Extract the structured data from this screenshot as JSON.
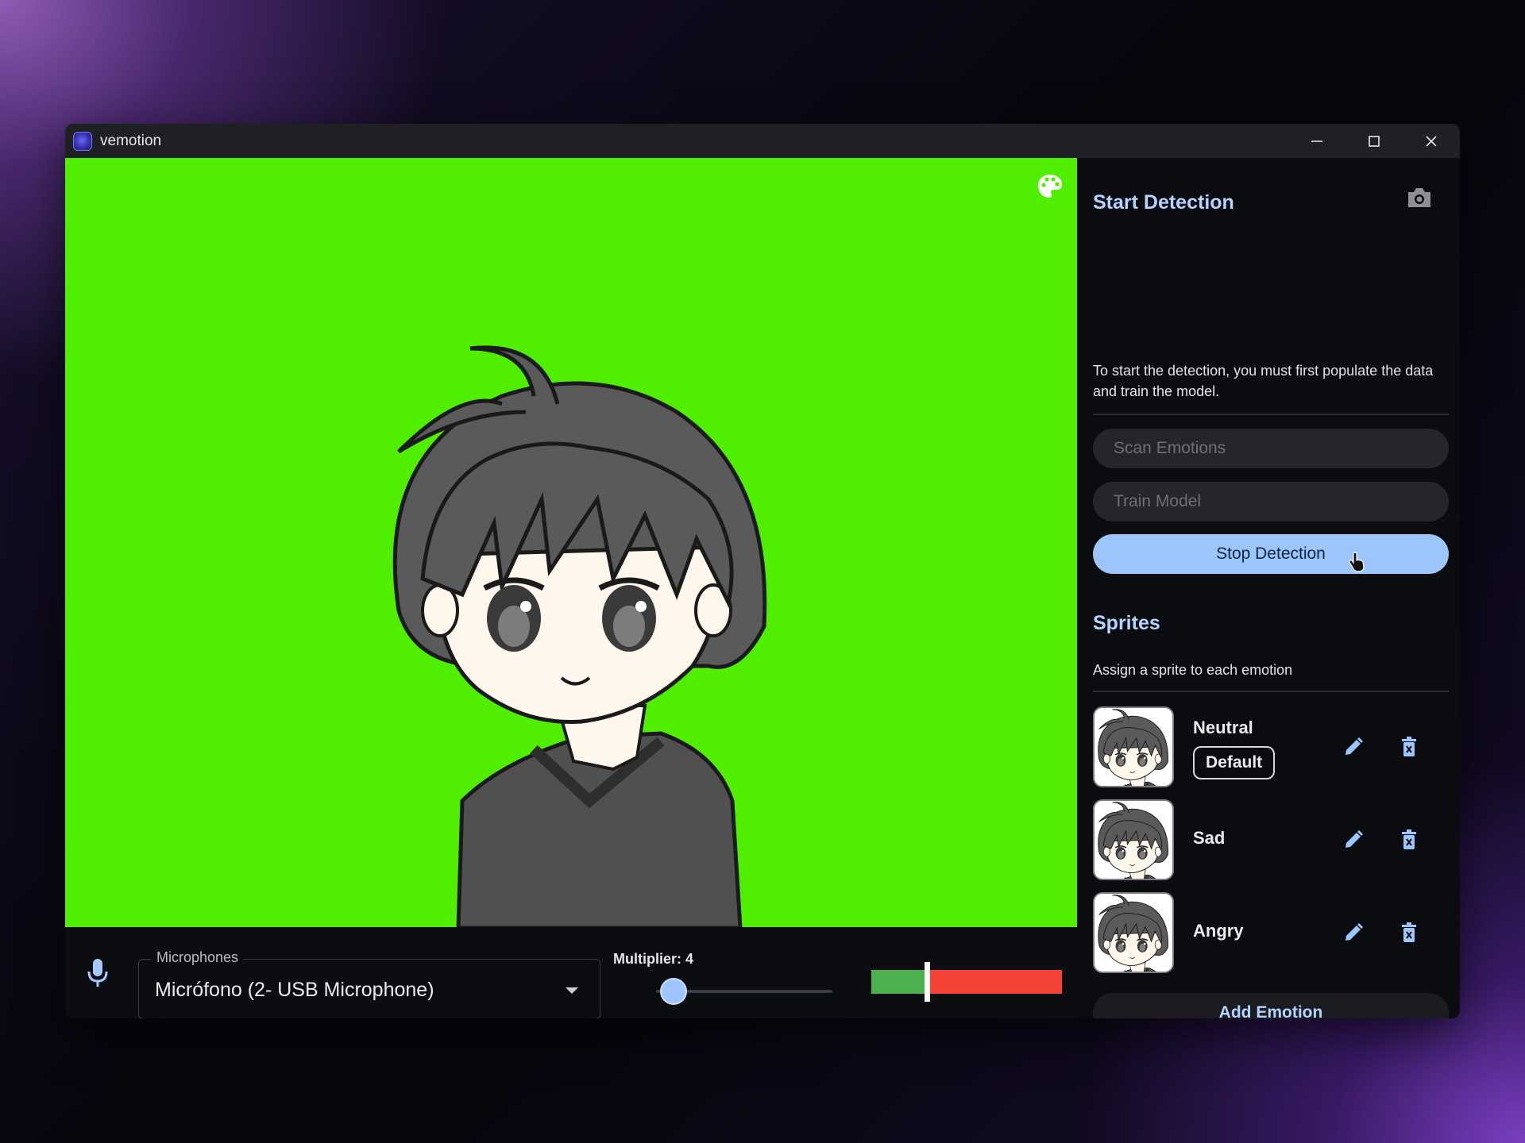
{
  "window": {
    "title": "vemotion"
  },
  "preview": {
    "background_color": "#50ee00"
  },
  "bottom_bar": {
    "microphones_label": "Microphones",
    "microphone_value": "Micrófono (2- USB Microphone)",
    "multiplier_label": "Multiplier: 4",
    "multiplier_slider_fraction": 0.1,
    "level_threshold_fraction": 0.29
  },
  "panel": {
    "detection": {
      "title": "Start Detection",
      "description": "To start the detection, you must first populate the data and train the model.",
      "scan_label": "Scan Emotions",
      "train_label": "Train Model",
      "stop_label": "Stop Detection"
    },
    "sprites": {
      "title": "Sprites",
      "description": "Assign a sprite to each emotion",
      "items": [
        {
          "name": "Neutral",
          "badge": "Default"
        },
        {
          "name": "Sad"
        },
        {
          "name": "Angry"
        }
      ]
    },
    "add_emotion_label": "Add Emotion"
  },
  "colors": {
    "accent": "#9cc5fb",
    "title_blue": "#b5d3ff",
    "level_green": "#4caf50",
    "level_red": "#f44336"
  }
}
